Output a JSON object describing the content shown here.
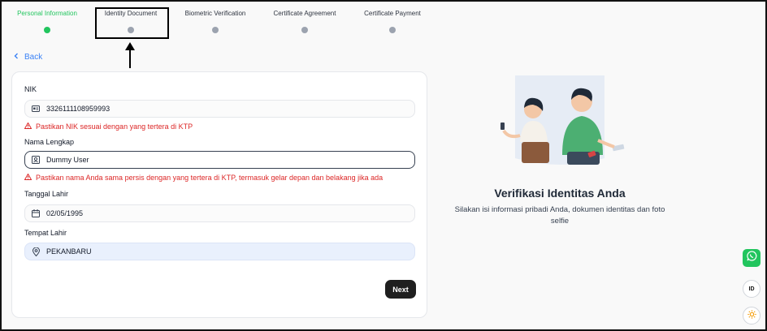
{
  "stepper": {
    "steps": [
      {
        "label": "Personal Information",
        "active": true
      },
      {
        "label": "Identity Document",
        "active": false
      },
      {
        "label": "Biometric Verification",
        "active": false
      },
      {
        "label": "Certificate Agreement",
        "active": false
      },
      {
        "label": "Certificate Payment",
        "active": false
      }
    ]
  },
  "nav": {
    "back_label": "Back"
  },
  "form": {
    "nik": {
      "label": "NIK",
      "value": "3326111108959993",
      "icon": "id-card-icon",
      "error": "Pastikan NIK sesuai dengan yang tertera di KTP"
    },
    "name": {
      "label": "Nama Lengkap",
      "value": "Dummy User",
      "icon": "user-badge-icon",
      "error": "Pastikan nama Anda sama persis dengan yang tertera di KTP, termasuk gelar depan dan belakang jika ada"
    },
    "dob": {
      "label": "Tanggal Lahir",
      "value": "02/05/1995",
      "icon": "calendar-icon"
    },
    "pob": {
      "label": "Tempat Lahir",
      "value": "PEKANBARU",
      "icon": "location-pin-icon"
    },
    "next_label": "Next"
  },
  "hero": {
    "title": "Verifikasi Identitas Anda",
    "subtitle": "Silakan isi informasi pribadi Anda, dokumen identitas dan foto selfie"
  },
  "floating": {
    "language": "ID"
  },
  "colors": {
    "active_step": "#22c55e",
    "inactive_step": "#9ca3af",
    "error": "#dc2626",
    "link": "#3b82f6",
    "button": "#1f1f1f"
  }
}
